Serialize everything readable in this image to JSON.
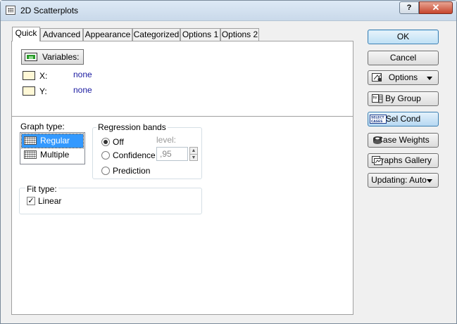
{
  "window": {
    "title": "2D Scatterplots",
    "help_label": "?",
    "close_label": "✕"
  },
  "tabs": [
    {
      "label": "Quick"
    },
    {
      "label": "Advanced"
    },
    {
      "label": "Appearance"
    },
    {
      "label": "Categorized"
    },
    {
      "label": "Options 1"
    },
    {
      "label": "Options 2"
    }
  ],
  "variables": {
    "button_label": "Variables:",
    "x": {
      "name": "X:",
      "value": "none"
    },
    "y": {
      "name": "Y:",
      "value": "none"
    }
  },
  "graph_type": {
    "label": "Graph type:",
    "options": [
      {
        "label": "Regular",
        "selected": true
      },
      {
        "label": "Multiple",
        "selected": false
      }
    ]
  },
  "regression_bands": {
    "label": "Regression bands",
    "options": [
      {
        "label": "Off",
        "selected": true
      },
      {
        "label": "Confidence",
        "selected": false
      },
      {
        "label": "Prediction",
        "selected": false
      }
    ],
    "level_label": "level:",
    "level_value": ",95"
  },
  "fit_type": {
    "label": "Fit type:",
    "linear_label": "Linear",
    "linear_checked": true
  },
  "side_buttons": {
    "ok": "OK",
    "cancel": "Cancel",
    "options": "Options",
    "by_group": "By Group",
    "sel_cond": "Sel Cond",
    "case_weights": "Case Weights",
    "graphs_gallery": "Graphs Gallery",
    "updating": "Updating: Auto"
  },
  "icons": {
    "app": "scatterplot-icon",
    "variables": "variables-icon",
    "options": "options-icon",
    "by_group": "by-group-icon",
    "sel_cond": "select-cases-icon",
    "case_weights": "weights-icon",
    "graphs_gallery": "gallery-icon"
  }
}
